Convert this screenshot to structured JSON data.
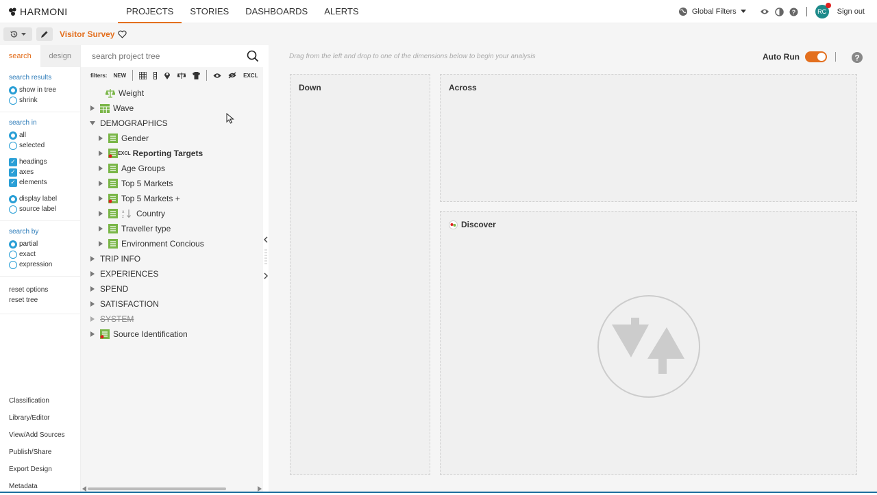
{
  "app": {
    "logo_text": "HARMONI"
  },
  "nav": {
    "items": [
      {
        "label": "PROJECTS",
        "active": true
      },
      {
        "label": "STORIES",
        "active": false
      },
      {
        "label": "DASHBOARDS",
        "active": false
      },
      {
        "label": "ALERTS",
        "active": false
      }
    ]
  },
  "topbar": {
    "global_filters": "Global Filters",
    "avatar_initials": "RC",
    "sign_out": "Sign out"
  },
  "project": {
    "title": "Visitor Survey"
  },
  "left_panel": {
    "tabs": [
      {
        "label": "search",
        "active": true
      },
      {
        "label": "design",
        "active": false
      }
    ],
    "search_results": {
      "heading": "search results",
      "options": [
        "show in tree",
        "shrink"
      ],
      "selected": "show in tree"
    },
    "search_in": {
      "heading": "search in",
      "scope_options": [
        "all",
        "selected"
      ],
      "scope_selected": "all",
      "checks": [
        "headings",
        "axes",
        "elements"
      ],
      "label_options": [
        "display label",
        "source label"
      ],
      "label_selected": "display label"
    },
    "search_by": {
      "heading": "search by",
      "options": [
        "partial",
        "exact",
        "expression"
      ],
      "selected": "partial"
    },
    "actions": [
      "reset options",
      "reset tree"
    ],
    "bottom_links": [
      "Classification",
      "Library/Editor",
      "View/Add Sources",
      "Publish/Share",
      "Export Design",
      "Metadata"
    ]
  },
  "tree_panel": {
    "search_placeholder": "search project tree",
    "filters_label": "filters:",
    "filter_new": "NEW",
    "filter_excl": "EXCL",
    "excl_tag": "EXCL",
    "nodes": [
      {
        "label": "Weight"
      },
      {
        "label": "Wave"
      },
      {
        "label": "DEMOGRAPHICS"
      },
      {
        "label": "Gender"
      },
      {
        "label": "Reporting Targets"
      },
      {
        "label": "Age Groups"
      },
      {
        "label": "Top 5 Markets"
      },
      {
        "label": "Top 5 Markets +"
      },
      {
        "label": "Country"
      },
      {
        "label": "Traveller type"
      },
      {
        "label": "Environment Concious"
      },
      {
        "label": "TRIP INFO"
      },
      {
        "label": "EXPERIENCES"
      },
      {
        "label": "SPEND"
      },
      {
        "label": "SATISFACTION"
      },
      {
        "label": "SYSTEM"
      },
      {
        "label": "Source Identification"
      }
    ]
  },
  "canvas": {
    "hint": "Drag from the left and drop to one of the dimensions below to begin your analysis",
    "auto_run_label": "Auto Run",
    "auto_run_on": true,
    "zones": {
      "down": "Down",
      "across": "Across",
      "discover": "Discover"
    }
  },
  "colors": {
    "accent": "#e36f1e",
    "link": "#2a7ab8",
    "radio": "#2a9fd6",
    "avatar": "#1d8a8a",
    "tree_icon": "#7ab648"
  }
}
